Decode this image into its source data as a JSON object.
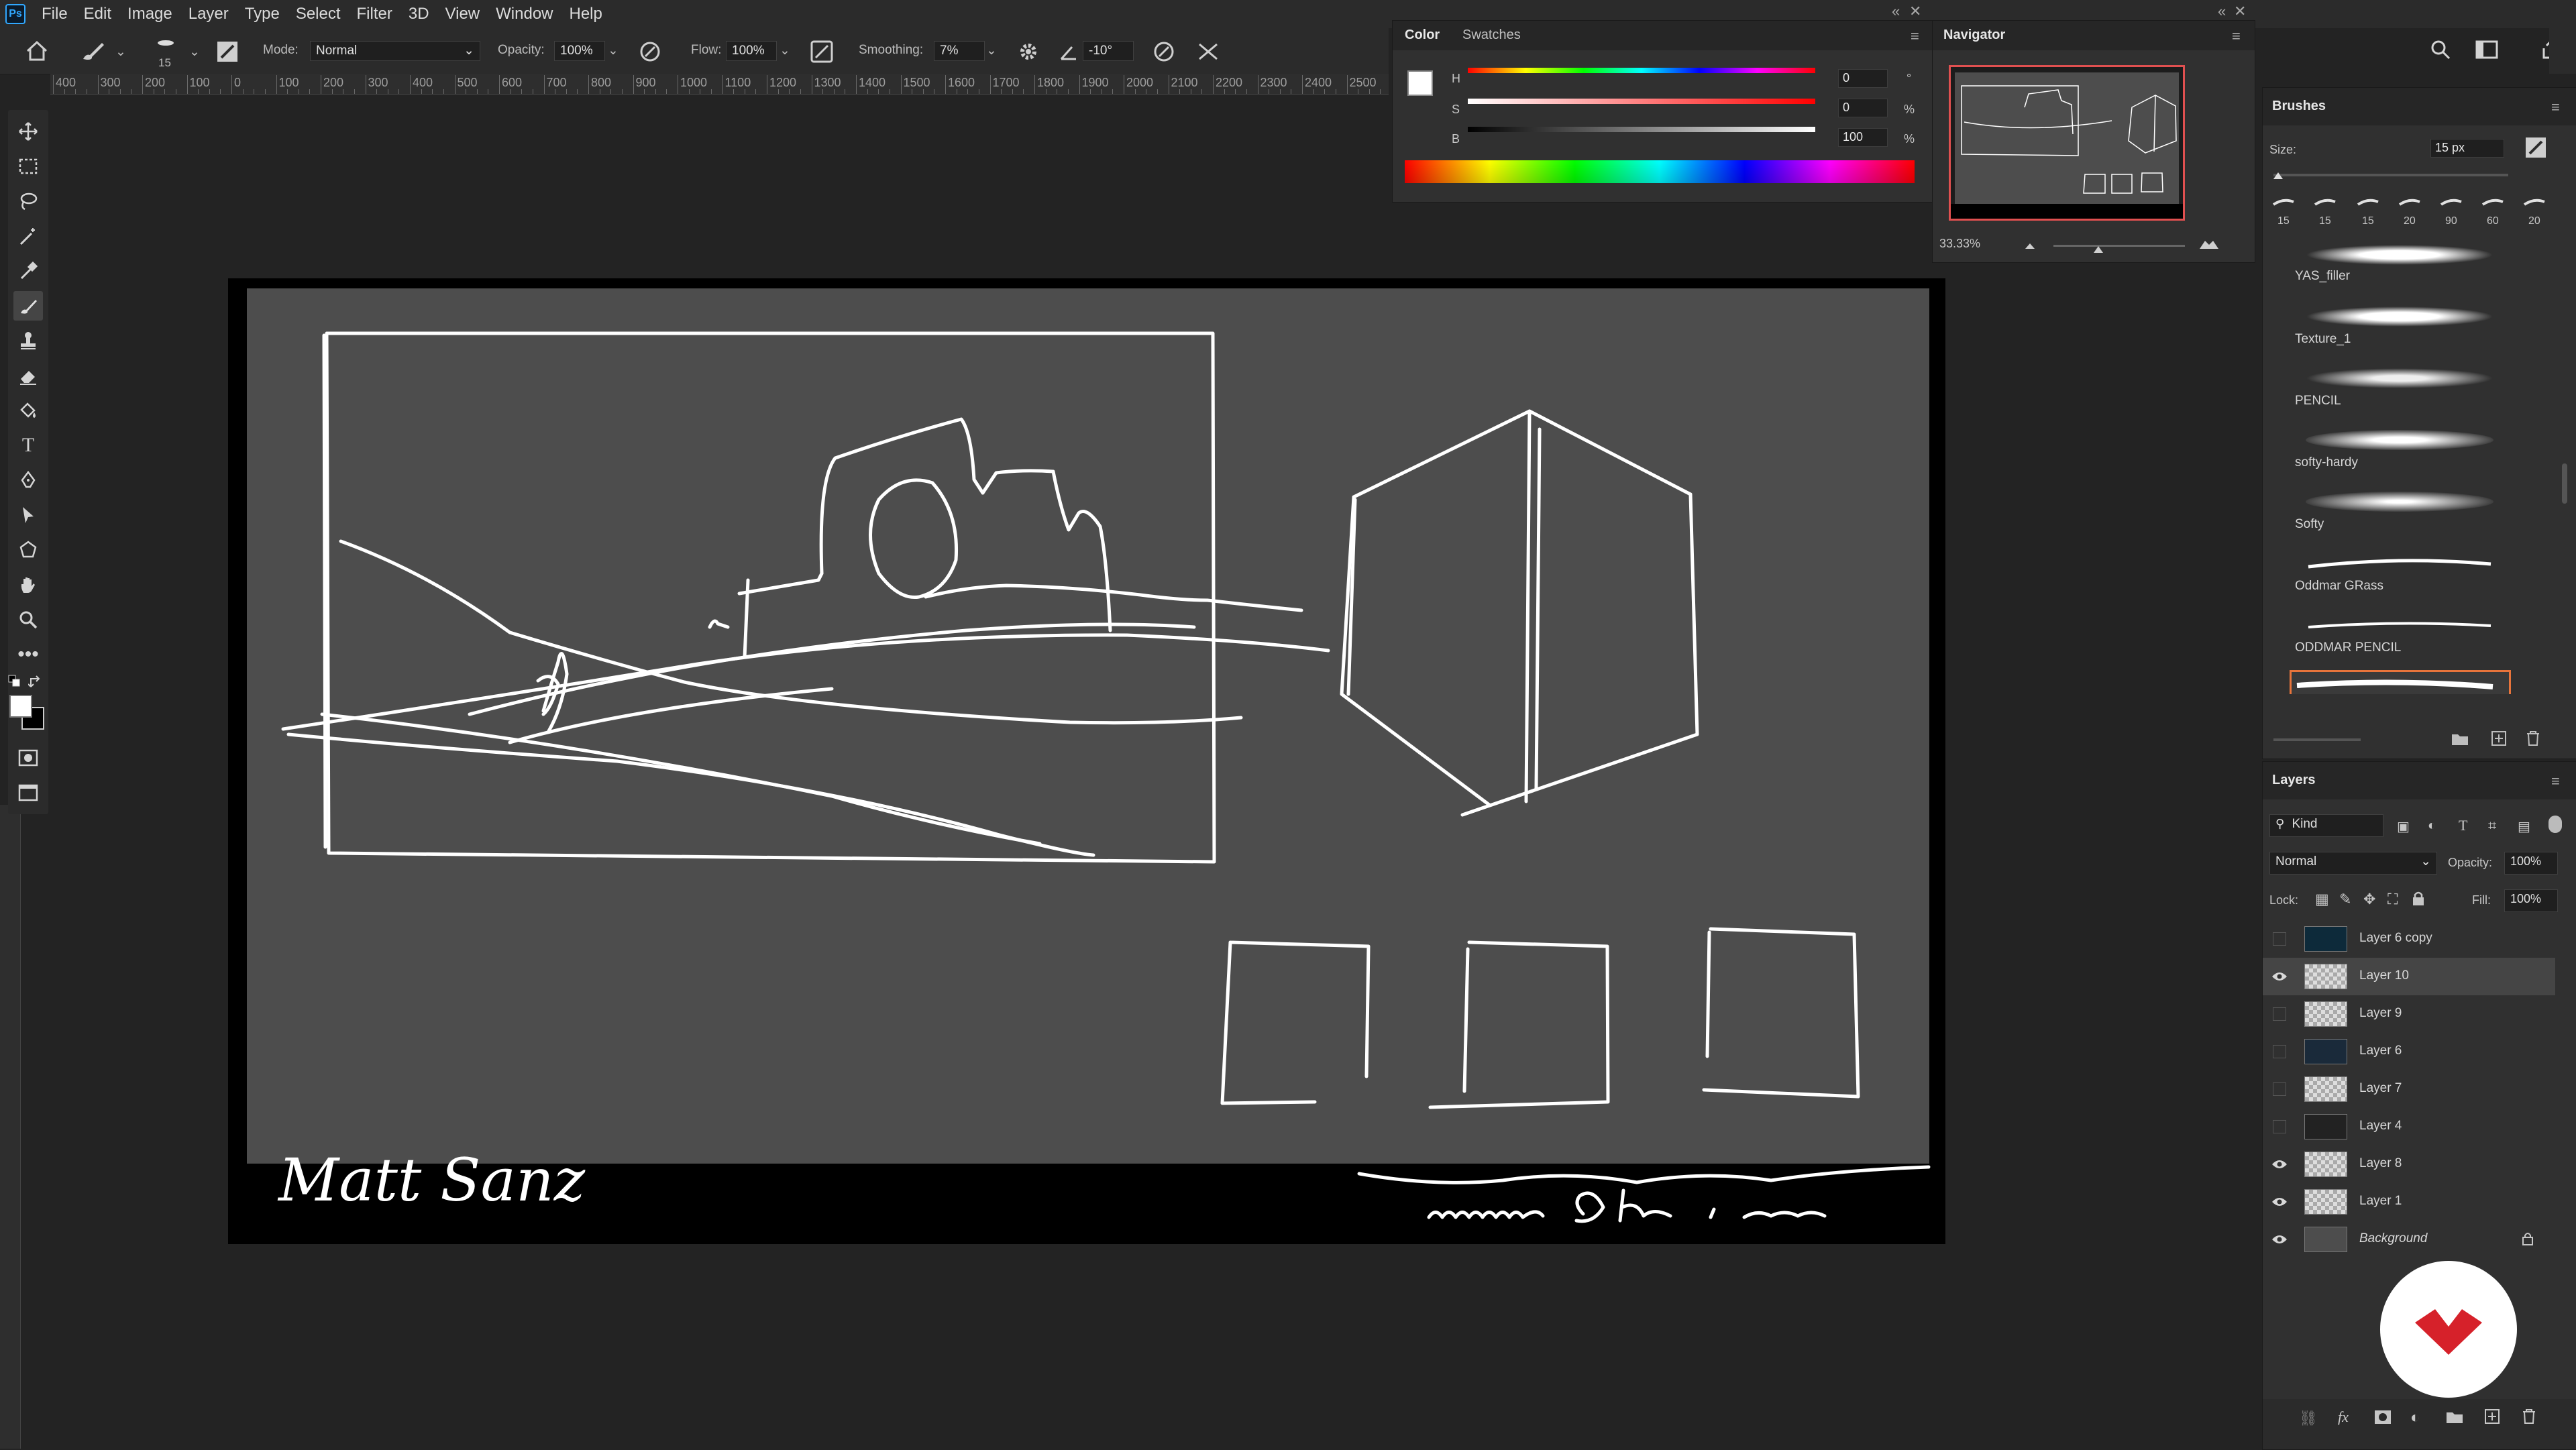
{
  "app": {
    "logo": "Ps"
  },
  "menu": [
    "File",
    "Edit",
    "Image",
    "Layer",
    "Type",
    "Select",
    "Filter",
    "3D",
    "View",
    "Window",
    "Help"
  ],
  "options_bar": {
    "brush_size": "15",
    "mode_label": "Mode:",
    "mode_value": "Normal",
    "opacity_label": "Opacity:",
    "opacity_value": "100%",
    "flow_label": "Flow:",
    "flow_value": "100%",
    "smoothing_label": "Smoothing:",
    "smoothing_value": "7%",
    "angle_value": "-10°"
  },
  "ruler": {
    "labels": [
      "400",
      "300",
      "200",
      "100",
      "0",
      "100",
      "200",
      "300",
      "400",
      "500",
      "600",
      "700",
      "800",
      "900",
      "1000",
      "1100",
      "1200",
      "1300",
      "1400",
      "1500",
      "1600",
      "1700",
      "1800",
      "1900",
      "2000",
      "2100",
      "2200",
      "2300",
      "2400",
      "2500"
    ]
  },
  "color_panel": {
    "tabs": [
      "Color",
      "Swatches"
    ],
    "h_label": "H",
    "h_value": "0",
    "h_unit": "°",
    "s_label": "S",
    "s_value": "0",
    "s_unit": "%",
    "b_label": "B",
    "b_value": "100",
    "b_unit": "%"
  },
  "navigator": {
    "title": "Navigator",
    "zoom": "33.33%"
  },
  "brushes": {
    "title": "Brushes",
    "size_label": "Size:",
    "size_value": "15 px",
    "preset_sizes": [
      "15",
      "15",
      "15",
      "20",
      "90",
      "60",
      "20"
    ],
    "items": [
      {
        "name": "YAS_filler",
        "selected": false
      },
      {
        "name": "Texture_1",
        "selected": false
      },
      {
        "name": "PENCIL",
        "selected": false
      },
      {
        "name": "softy-hardy",
        "selected": false
      },
      {
        "name": "Softy",
        "selected": false
      },
      {
        "name": "Oddmar GRass",
        "selected": false
      },
      {
        "name": "ODDMAR PENCIL",
        "selected": false
      },
      {
        "name": "icon",
        "selected": true
      }
    ]
  },
  "layers": {
    "title": "Layers",
    "filter_label": "Kind",
    "blend_mode": "Normal",
    "opacity_label": "Opacity:",
    "opacity_value": "100%",
    "lock_label": "Lock:",
    "fill_label": "Fill:",
    "fill_value": "100%",
    "items": [
      {
        "name": "Layer 6 copy",
        "visible": false,
        "selected": false
      },
      {
        "name": "Layer 10",
        "visible": true,
        "selected": true
      },
      {
        "name": "Layer 9",
        "visible": false,
        "selected": false
      },
      {
        "name": "Layer 6",
        "visible": false,
        "selected": false
      },
      {
        "name": "Layer 7",
        "visible": false,
        "selected": false
      },
      {
        "name": "Layer 4",
        "visible": false,
        "selected": false
      },
      {
        "name": "Layer 8",
        "visible": true,
        "selected": false
      },
      {
        "name": "Layer 1",
        "visible": true,
        "selected": false
      },
      {
        "name": "Background",
        "visible": true,
        "selected": false
      }
    ]
  },
  "canvas": {
    "signature": "Matt Sanz",
    "art_background": "#4d4d4d"
  },
  "colors": {
    "accent_selected": "#e8743b",
    "navigator_frame": "#e05050",
    "brand_red": "#d6212a"
  }
}
